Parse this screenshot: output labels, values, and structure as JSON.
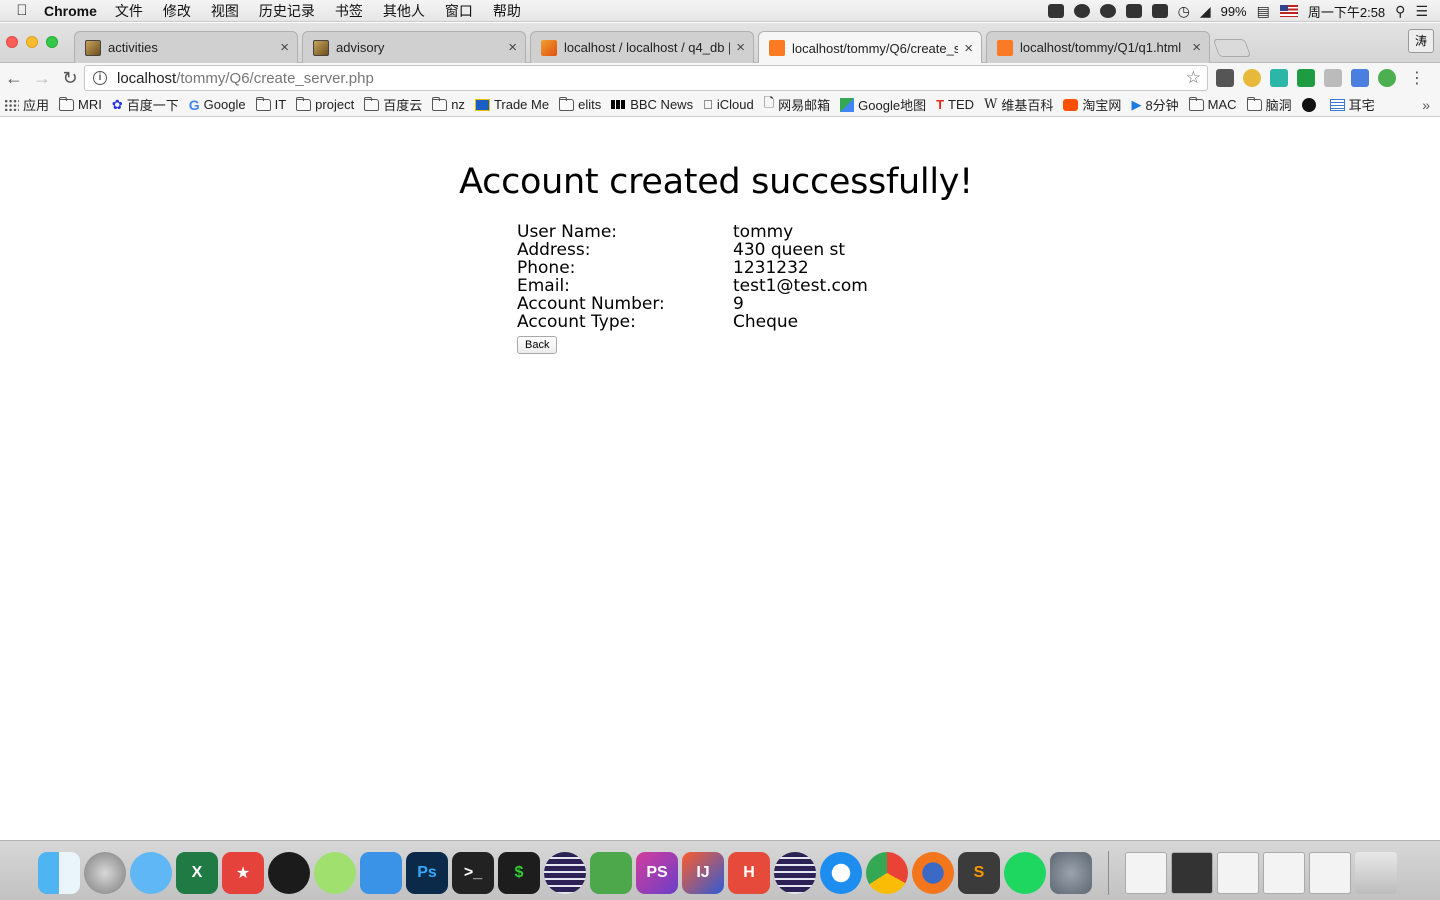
{
  "menubar": {
    "app_name": "Chrome",
    "items": [
      "文件",
      "修改",
      "视图",
      "历史记录",
      "书签",
      "其他人",
      "窗口",
      "帮助"
    ],
    "battery": "99%",
    "clock": "周一下午2:58"
  },
  "tabs": [
    {
      "title": "activities",
      "favicon": "image-favicon"
    },
    {
      "title": "advisory",
      "favicon": "image-favicon"
    },
    {
      "title": "localhost / localhost / q4_db | ",
      "favicon": "phpmyadmin-favicon"
    },
    {
      "title": "localhost/tommy/Q6/create_se",
      "favicon": "xampp-favicon",
      "active": true
    },
    {
      "title": "localhost/tommy/Q1/q1.html",
      "favicon": "xampp-favicon"
    }
  ],
  "profile_button": "涛",
  "address_bar": {
    "host": "localhost",
    "path": "/tommy/Q6/create_server.php"
  },
  "bookmarks": [
    {
      "label": "应用",
      "icon": "apps-icon"
    },
    {
      "label": "MRI",
      "icon": "folder-icon"
    },
    {
      "label": "百度一下",
      "icon": "baidu-icon"
    },
    {
      "label": "Google",
      "icon": "google-icon"
    },
    {
      "label": "IT",
      "icon": "folder-icon"
    },
    {
      "label": "project",
      "icon": "folder-icon"
    },
    {
      "label": "百度云",
      "icon": "folder-icon"
    },
    {
      "label": "nz",
      "icon": "folder-icon"
    },
    {
      "label": "Trade Me",
      "icon": "trademe-icon"
    },
    {
      "label": "elits",
      "icon": "folder-icon"
    },
    {
      "label": "BBC News",
      "icon": "bbc-icon"
    },
    {
      "label": "iCloud",
      "icon": "apple-icon"
    },
    {
      "label": "网易邮箱",
      "icon": "page-icon"
    },
    {
      "label": "Google地图",
      "icon": "maps-icon"
    },
    {
      "label": "TED",
      "icon": "ted-icon"
    },
    {
      "label": "维基百科",
      "icon": "wikipedia-icon"
    },
    {
      "label": "淘宝网",
      "icon": "taobao-icon"
    },
    {
      "label": "8分钟",
      "icon": "play-icon"
    },
    {
      "label": "MAC",
      "icon": "folder-icon"
    },
    {
      "label": "脑洞",
      "icon": "folder-icon"
    },
    {
      "label": "",
      "icon": "segmentfault-icon"
    },
    {
      "label": "耳宅",
      "icon": "doc-icon"
    }
  ],
  "page": {
    "title": "Account created successfully!",
    "fields": [
      {
        "label": "User Name:",
        "value": "tommy"
      },
      {
        "label": "Address:",
        "value": "430 queen st"
      },
      {
        "label": "Phone:",
        "value": "1231232"
      },
      {
        "label": "Email:",
        "value": "test1@test.com"
      },
      {
        "label": "Account Number:",
        "value": "9"
      },
      {
        "label": "Account Type:",
        "value": "Cheque"
      }
    ],
    "back_button": "Back"
  },
  "dock_apps": [
    "finder",
    "launchpad",
    "messages",
    "excel",
    "wunderlist",
    "qq",
    "wechat",
    "app-store",
    "photoshop",
    "terminal",
    "console",
    "eclipse",
    "evernote",
    "phpstorm",
    "intellij",
    "html-editor",
    "eclipse",
    "safari",
    "chrome",
    "firefox",
    "sublime-text",
    "spotify",
    "system-preferences"
  ]
}
